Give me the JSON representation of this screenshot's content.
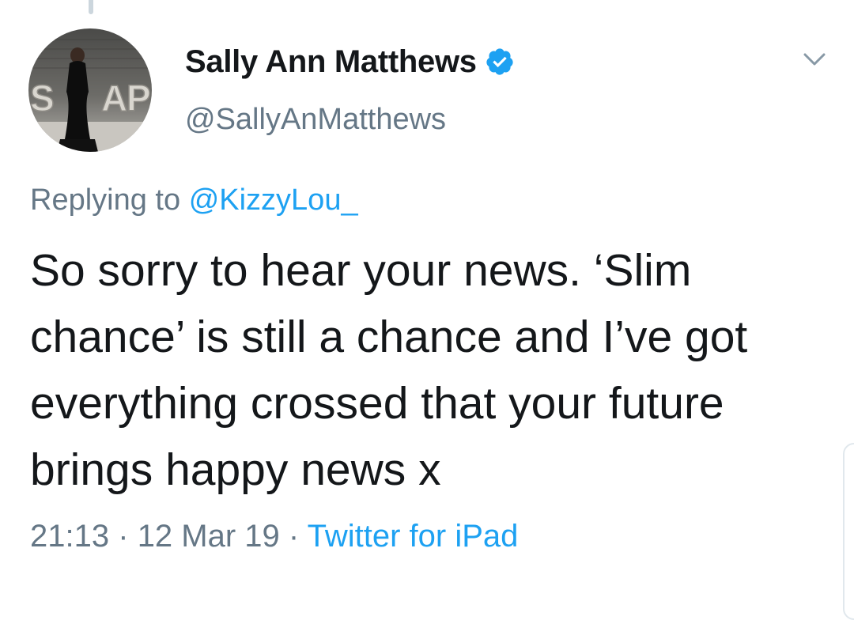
{
  "tweet": {
    "author": {
      "display_name": "Sally Ann Matthews",
      "handle": "@SallyAnMatthews",
      "verified": true,
      "avatar_lettering": "SOAP"
    },
    "reply": {
      "prefix": "Replying to",
      "mention": "@KizzyLou_"
    },
    "text": "So sorry to hear your news. ‘Slim chance’ is still a chance and I’ve got everything crossed that your future brings happy news x",
    "time": "21:13",
    "date": "12 Mar 19",
    "separator": "·",
    "source": "Twitter for iPad"
  },
  "icons": {
    "verified": "verified-badge-icon",
    "menu": "chevron-down-icon"
  },
  "colors": {
    "link": "#1da1f2",
    "secondary_text": "#657786",
    "primary_text": "#14171a",
    "verified": "#1da1f2"
  }
}
